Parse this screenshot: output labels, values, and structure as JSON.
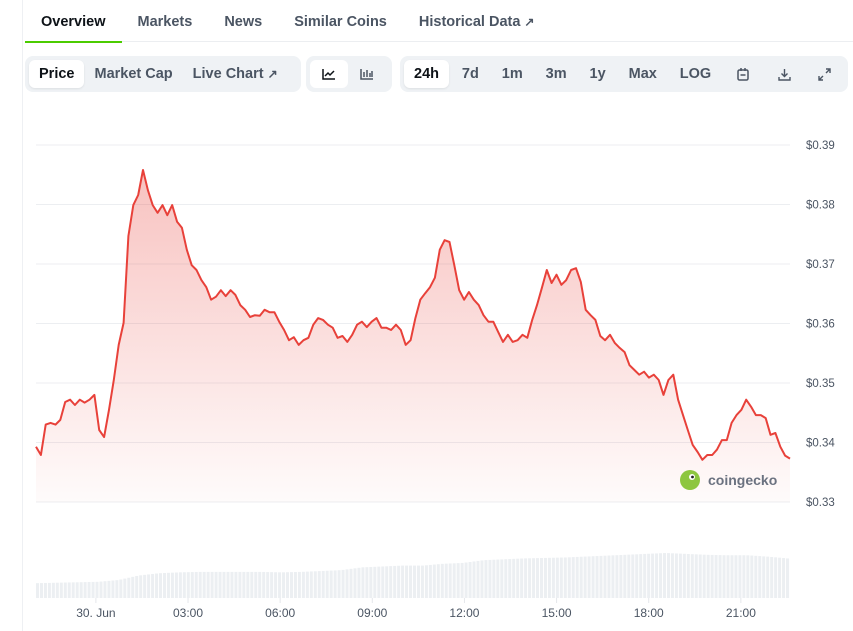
{
  "tabs": [
    {
      "label": "Overview"
    },
    {
      "label": "Markets"
    },
    {
      "label": "News"
    },
    {
      "label": "Similar Coins"
    },
    {
      "label": "Historical Data"
    }
  ],
  "toolbar": {
    "metrics": [
      "Price",
      "Market Cap",
      "Live Chart"
    ],
    "ranges": [
      "24h",
      "7d",
      "1m",
      "3m",
      "1y",
      "Max",
      "LOG"
    ]
  },
  "watermark": "coingecko",
  "colors": {
    "line": "#e8413a",
    "accent": "#4bcc00",
    "volume": "#eceff2"
  },
  "chart_data": {
    "type": "line",
    "series_name": "Price",
    "start_hour": -1.95,
    "end_hour": 22.6,
    "prices": [
      0.3393,
      0.3379,
      0.343,
      0.3433,
      0.343,
      0.3438,
      0.3468,
      0.3472,
      0.3463,
      0.3472,
      0.3467,
      0.3472,
      0.348,
      0.3421,
      0.3409,
      0.3455,
      0.3505,
      0.3564,
      0.3601,
      0.3747,
      0.3799,
      0.3816,
      0.3858,
      0.3824,
      0.3799,
      0.3786,
      0.3799,
      0.3782,
      0.3799,
      0.3771,
      0.3761,
      0.3724,
      0.3698,
      0.369,
      0.3673,
      0.3661,
      0.364,
      0.3645,
      0.3656,
      0.3646,
      0.3656,
      0.3648,
      0.3631,
      0.3623,
      0.3611,
      0.3614,
      0.3613,
      0.3623,
      0.3619,
      0.3619,
      0.3603,
      0.3589,
      0.3572,
      0.3577,
      0.3564,
      0.3572,
      0.3576,
      0.3598,
      0.3609,
      0.3606,
      0.3598,
      0.3593,
      0.3576,
      0.3579,
      0.3569,
      0.3581,
      0.3598,
      0.3603,
      0.3594,
      0.3603,
      0.3609,
      0.3593,
      0.3593,
      0.3589,
      0.3598,
      0.3589,
      0.3564,
      0.3572,
      0.3609,
      0.364,
      0.3651,
      0.3661,
      0.3677,
      0.3724,
      0.374,
      0.3737,
      0.3698,
      0.3656,
      0.364,
      0.3653,
      0.364,
      0.3631,
      0.3614,
      0.3603,
      0.3603,
      0.3586,
      0.3569,
      0.3581,
      0.3569,
      0.3572,
      0.3581,
      0.3576,
      0.3606,
      0.3631,
      0.366,
      0.369,
      0.3668,
      0.3682,
      0.3665,
      0.3673,
      0.369,
      0.3693,
      0.367,
      0.3623,
      0.3614,
      0.3606,
      0.3579,
      0.3572,
      0.3581,
      0.3567,
      0.3559,
      0.3552,
      0.353,
      0.3522,
      0.3514,
      0.3519,
      0.3509,
      0.3514,
      0.3505,
      0.348,
      0.3505,
      0.3514,
      0.3472,
      0.3446,
      0.3421,
      0.3396,
      0.3384,
      0.3371,
      0.3379,
      0.3379,
      0.3388,
      0.3404,
      0.3404,
      0.3433,
      0.3446,
      0.3455,
      0.3472,
      0.346,
      0.3446,
      0.3446,
      0.3441,
      0.3413,
      0.3416,
      0.3393,
      0.3378,
      0.3373
    ],
    "volumes": [
      33,
      34,
      35,
      36,
      40,
      50,
      55,
      57,
      58,
      58,
      58,
      58,
      57,
      58,
      60,
      62,
      68,
      70,
      72,
      72,
      76,
      78,
      84,
      86,
      88,
      89,
      90,
      92,
      94,
      96,
      98,
      100,
      98,
      96,
      95,
      95,
      92,
      88
    ],
    "yticks": [
      "$0.39",
      "$0.38",
      "$0.37",
      "$0.36",
      "$0.35",
      "$0.34",
      "$0.33"
    ],
    "ytick_values": [
      0.39,
      0.38,
      0.37,
      0.36,
      0.35,
      0.34,
      0.33
    ],
    "ylim": [
      0.33,
      0.39
    ],
    "xticks": [
      "30. Jun",
      "03:00",
      "06:00",
      "09:00",
      "12:00",
      "15:00",
      "18:00",
      "21:00"
    ],
    "xtick_hours": [
      0,
      3,
      6,
      9,
      12,
      15,
      18,
      21
    ]
  }
}
